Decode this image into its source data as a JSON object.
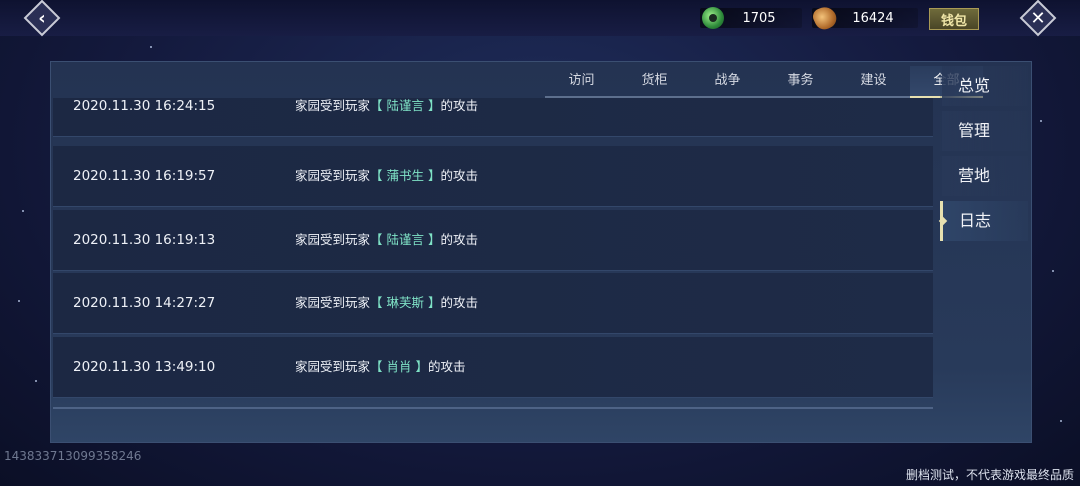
{
  "topbar": {
    "back_icon": "back-chevron-icon",
    "jade_amount": "1705",
    "coin_amount": "16424",
    "wallet_label": "钱包",
    "close_icon": "close-icon"
  },
  "tabs": [
    {
      "label": "访问",
      "active": false
    },
    {
      "label": "货柜",
      "active": false
    },
    {
      "label": "战争",
      "active": false
    },
    {
      "label": "事务",
      "active": false
    },
    {
      "label": "建设",
      "active": false
    },
    {
      "label": "全部",
      "active": true
    }
  ],
  "logs": [
    {
      "time": "2020.11.30 16:24:15",
      "prefix": "家园受到玩家",
      "name": "【 陆谨言 】",
      "suffix": "的攻击"
    },
    {
      "time": "2020.11.30 16:19:57",
      "prefix": "家园受到玩家",
      "name": "【 蒲书生 】",
      "suffix": "的攻击"
    },
    {
      "time": "2020.11.30 16:19:13",
      "prefix": "家园受到玩家",
      "name": "【 陆谨言 】",
      "suffix": "的攻击"
    },
    {
      "time": "2020.11.30 14:27:27",
      "prefix": "家园受到玩家",
      "name": "【 琳芙斯 】",
      "suffix": "的攻击"
    },
    {
      "time": "2020.11.30 13:49:10",
      "prefix": "家园受到玩家",
      "name": "【 肖肖 】",
      "suffix": "的攻击"
    }
  ],
  "side_nav": [
    {
      "label": "总览",
      "active": false
    },
    {
      "label": "管理",
      "active": false
    },
    {
      "label": "营地",
      "active": false
    },
    {
      "label": "日志",
      "active": true
    }
  ],
  "footer": {
    "player_id": "14383371309935824​6",
    "notice": "删档测试，不代表游戏最终品质"
  },
  "colors": {
    "accent": "#e8e1b0",
    "name_highlight": "#7fe2c6"
  }
}
